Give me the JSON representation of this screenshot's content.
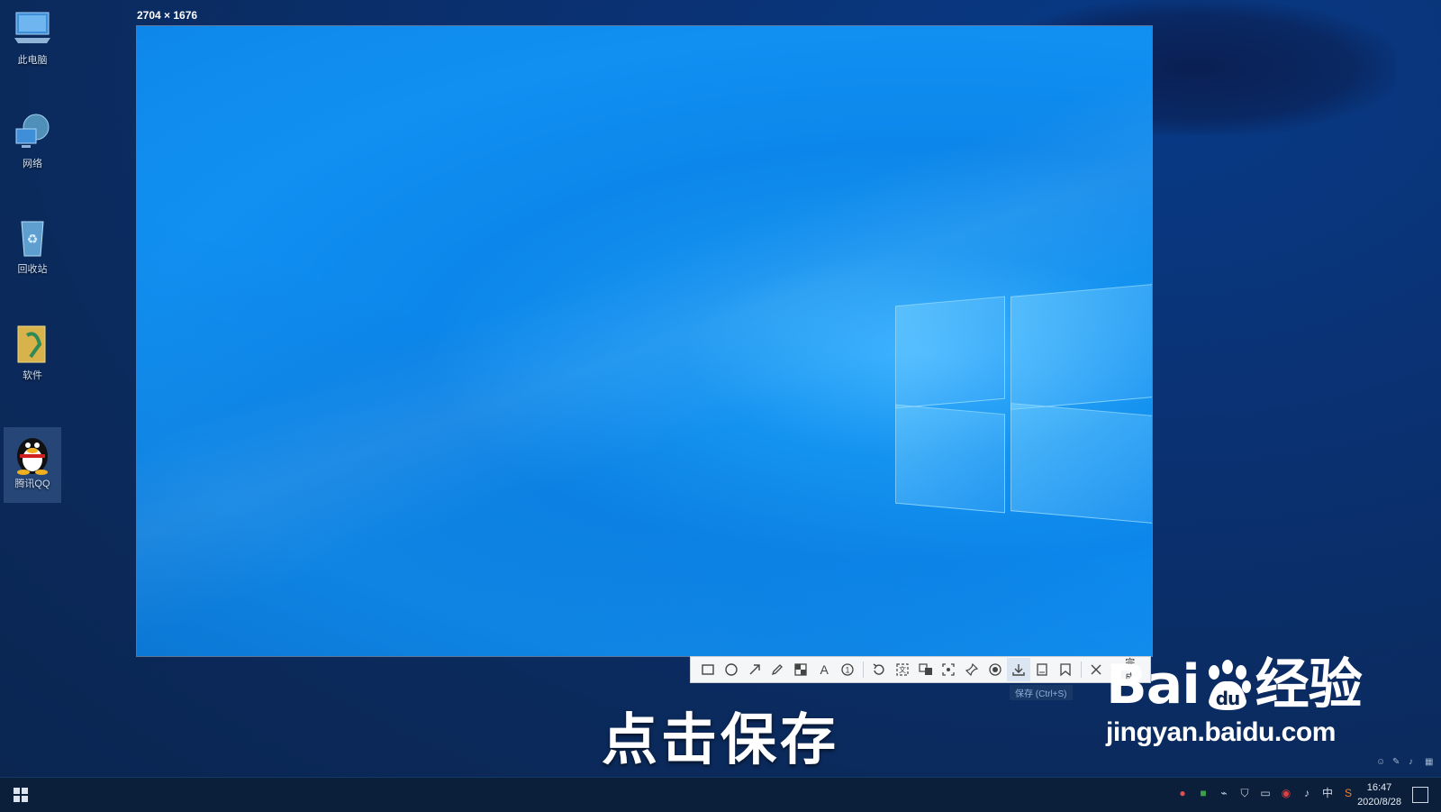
{
  "desktop_icons": [
    {
      "label": "此电脑",
      "icon": "computer-icon"
    },
    {
      "label": "网络",
      "icon": "network-icon"
    },
    {
      "label": "回收站",
      "icon": "recycle-bin-icon"
    },
    {
      "label": "软件",
      "icon": "folder-icon"
    },
    {
      "label": "腾讯QQ",
      "icon": "qq-penguin-icon"
    }
  ],
  "capture": {
    "size_label": "2704 × 1676"
  },
  "toolbar": {
    "tools": [
      "rectangle-icon",
      "ellipse-icon",
      "arrow-icon",
      "pen-icon",
      "mosaic-icon",
      "text-icon",
      "number-icon",
      "undo-icon",
      "ocr-icon",
      "translate-icon",
      "long-screenshot-icon",
      "pin-icon",
      "record-icon",
      "save-icon",
      "share-icon",
      "bookmark-icon"
    ],
    "cancel_icon": "close-icon",
    "done_label": "完成",
    "tooltip": "保存 (Ctrl+S)"
  },
  "caption": "点击保存",
  "watermark": {
    "brand_left": "Bai",
    "brand_right": "经验",
    "paw_text": "du",
    "url": "jingyan.baidu.com"
  },
  "taskbar": {
    "ime": "中",
    "time": "16:47",
    "date": "2020/8/28"
  },
  "colors": {
    "desktop_bg": "#0a3172",
    "wallpaper_blue": "#0c86ea",
    "taskbar": "#0b1f3a"
  }
}
